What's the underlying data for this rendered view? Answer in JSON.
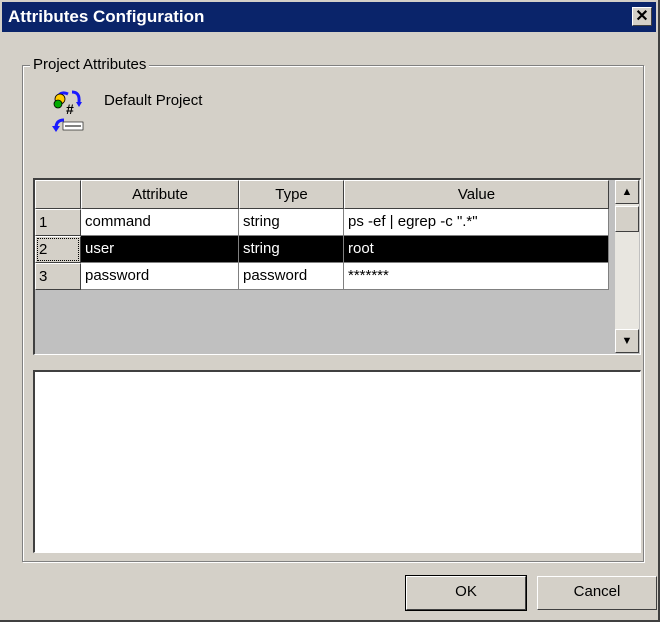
{
  "window": {
    "title": "Attributes Configuration",
    "close_symbol": "✕"
  },
  "group": {
    "label": "Project Attributes",
    "project_name": "Default Project",
    "project_icon": "project-attributes-icon"
  },
  "grid": {
    "columns": [
      "Attribute",
      "Type",
      "Value"
    ],
    "rows": [
      {
        "num": "1",
        "attribute": "command",
        "type": "string",
        "value": "ps -ef | egrep -c \".*\""
      },
      {
        "num": "2",
        "attribute": "user",
        "type": "string",
        "value": "root"
      },
      {
        "num": "3",
        "attribute": "password",
        "type": "password",
        "value": "*******"
      }
    ],
    "selected_row": 2,
    "scroll_up_symbol": "▲",
    "scroll_down_symbol": "▼"
  },
  "buttons": {
    "ok": "OK",
    "cancel": "Cancel"
  },
  "colors": {
    "title_bar": "#0a246a",
    "face": "#d4d0c8",
    "selection": "#000000"
  }
}
